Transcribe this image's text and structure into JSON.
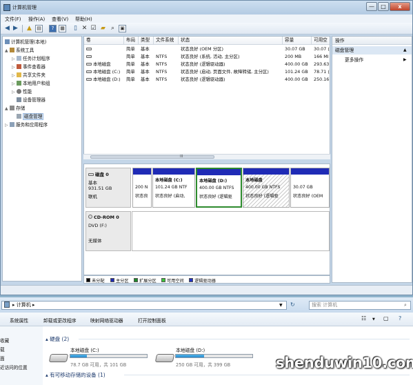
{
  "window": {
    "title": "计算机管理",
    "min": "—",
    "max": "□",
    "close": "x"
  },
  "menu": [
    "文件(F)",
    "操作(A)",
    "查看(V)",
    "帮助(H)"
  ],
  "toolbar": {
    "back_icon": "back-arrow-icon",
    "forward_icon": "forward-arrow-icon",
    "icons": [
      "up-folder-icon",
      "show-tree-icon",
      "help-icon",
      "properties-icon",
      "delete-icon",
      "properties-icon",
      "open-icon",
      "search-icon",
      "settings-icon"
    ]
  },
  "tree": {
    "root": "计算机管理(本地)",
    "items": [
      {
        "label": "系统工具",
        "level": 1,
        "expander": "▲"
      },
      {
        "label": "任务计划程序",
        "level": 2,
        "expander": "▷"
      },
      {
        "label": "事件查看器",
        "level": 2,
        "expander": "▷"
      },
      {
        "label": "共享文件夹",
        "level": 2,
        "expander": "▷"
      },
      {
        "label": "本地用户和组",
        "level": 2,
        "expander": "▷"
      },
      {
        "label": "性能",
        "level": 2,
        "expander": "▷"
      },
      {
        "label": "设备管理器",
        "level": 2,
        "expander": ""
      },
      {
        "label": "存储",
        "level": 1,
        "expander": "▲"
      },
      {
        "label": "磁盘管理",
        "level": 2,
        "expander": "",
        "selected": true
      },
      {
        "label": "服务和应用程序",
        "level": 1,
        "expander": "▷"
      }
    ]
  },
  "volumes": {
    "columns": [
      "卷",
      "布局",
      "类型",
      "文件系统",
      "状态",
      "容量",
      "可用空"
    ],
    "rows": [
      [
        "",
        "简单",
        "基本",
        "",
        "状态良好 (OEM 分区)",
        "30.07 GB",
        "30.07 ("
      ],
      [
        "",
        "简单",
        "基本",
        "NTFS",
        "状态良好 (系统, 活动, 主分区)",
        "200 MB",
        "166 MI"
      ],
      [
        "本地磁盘",
        "简单",
        "基本",
        "NTFS",
        "状态良好 (逻辑驱动器)",
        "400.00 GB",
        "293.63"
      ],
      [
        "本地磁盘 (C:)",
        "简单",
        "基本",
        "NTFS",
        "状态良好 (启动, 页面文件, 故障转储, 主分区)",
        "101.24 GB",
        "78.71 ("
      ],
      [
        "本地磁盘 (D:)",
        "简单",
        "基本",
        "NTFS",
        "状态良好 (逻辑驱动器)",
        "400.00 GB",
        "250.16"
      ]
    ],
    "scroll_label": "III"
  },
  "disks": {
    "disk0": {
      "name": "磁盘 0",
      "type": "基本",
      "size": "931.51 GB",
      "status": "联机",
      "partitions": [
        {
          "l1": "",
          "l2": "200 N",
          "l3": "状态良"
        },
        {
          "l1": "本地磁盘 (C:)",
          "l2": "101.24 GB NTF",
          "l3": "状态良好 (启动,"
        },
        {
          "l1": "本地磁盘 (D:)",
          "l2": "400.00 GB NTFS",
          "l3": "状态良好 (逻辑驱",
          "selected": true
        },
        {
          "l1": "本地磁盘",
          "l2": "400.00 GB NTFS",
          "l3": "状态良好 (逻辑驱",
          "hatched": true
        },
        {
          "l1": "",
          "l2": "30.07 GB",
          "l3": "状态良好 (OEM"
        }
      ]
    },
    "cdrom0": {
      "name": "CD-ROM 0",
      "type": "DVD (F:)",
      "status": "无媒体"
    }
  },
  "legend": [
    {
      "label": "未分配",
      "color": "#000000"
    },
    {
      "label": "主分区",
      "color": "#1f2bb6"
    },
    {
      "label": "扩展分区",
      "color": "#1d8a2a"
    },
    {
      "label": "可用空间",
      "color": "#3cc43c"
    },
    {
      "label": "逻辑驱动器",
      "color": "#2133c4"
    }
  ],
  "actions": {
    "header": "操作",
    "section": "磁盘管理",
    "section_arrow": "▲",
    "more": "更多操作",
    "more_arrow": "▶"
  },
  "explorer": {
    "address": "▸ 计算机 ▸",
    "search_placeholder": "搜索 计算机",
    "commands": [
      "系统属性",
      "卸载或更改程序",
      "映射网络驱动器",
      "打开控制面板"
    ],
    "nav": [
      "收藏",
      "载",
      "面",
      "近访问的位置"
    ],
    "group_drives": "硬盘 (2)",
    "group_removable": "有可移动存储的设备 (1)",
    "drives": [
      {
        "name": "本地磁盘 (C:)",
        "free": "78.7 GB 可用，共 101 GB",
        "used_fraction": 0.22
      },
      {
        "name": "本地磁盘 (D:)",
        "free": "250 GB 可用，共 399 GB",
        "used_fraction": 0.37
      }
    ]
  },
  "watermark": "shenduwin10.com"
}
